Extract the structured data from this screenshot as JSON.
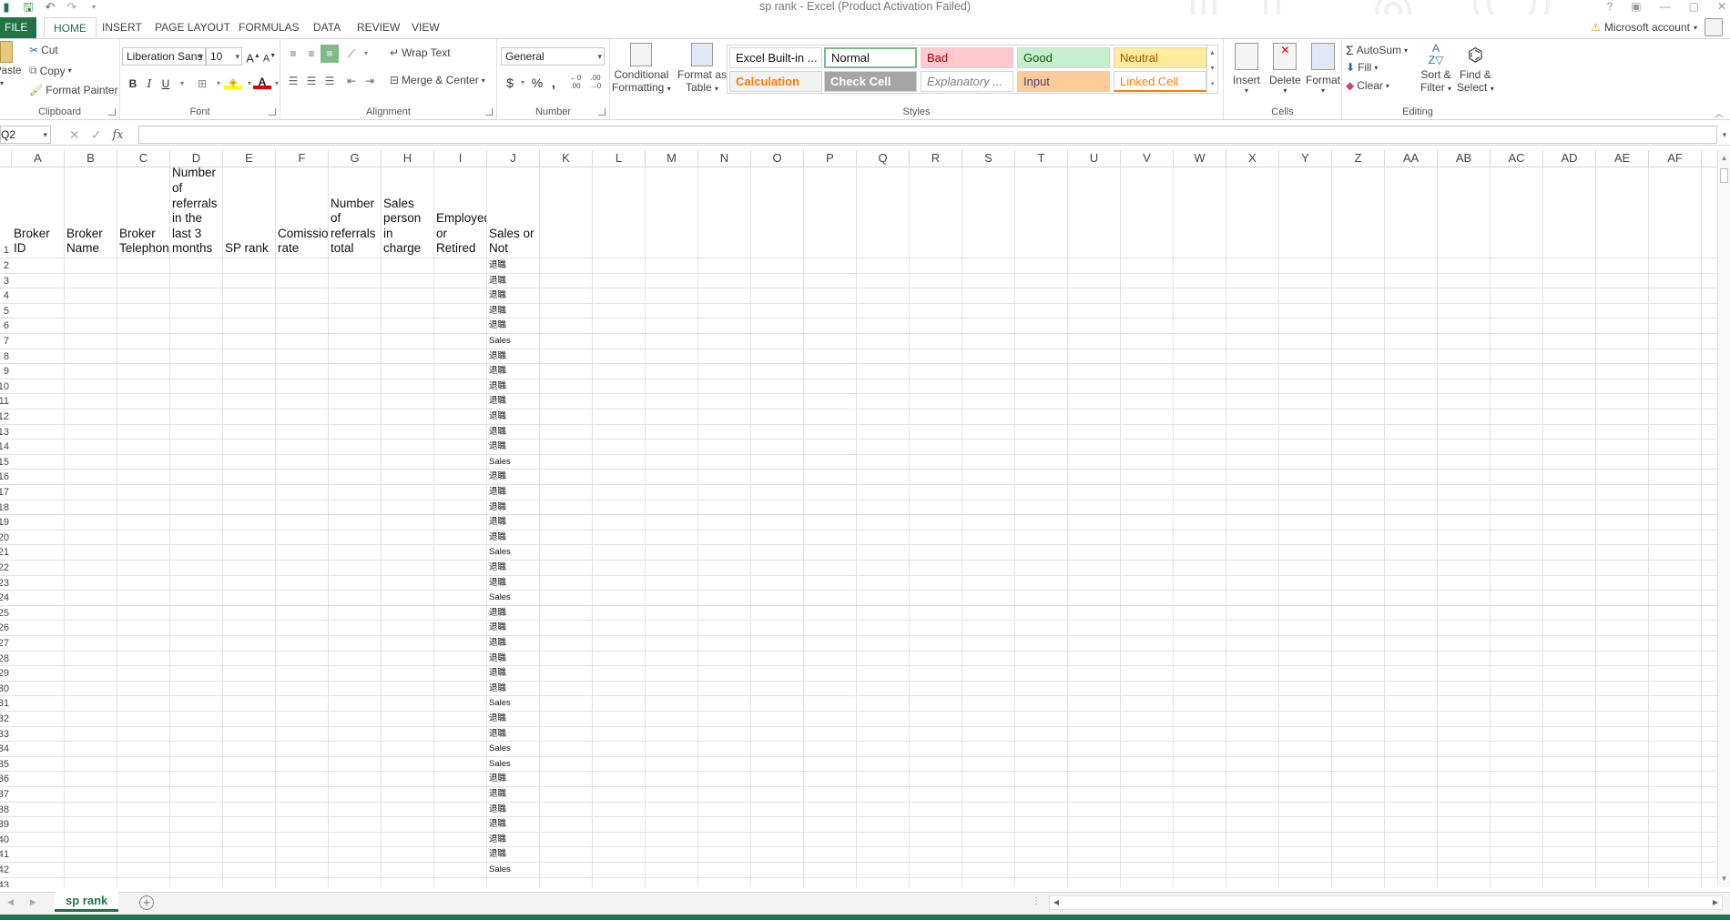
{
  "window": {
    "title": "sp rank - Excel (Product Activation Failed)",
    "account": "Microsoft account",
    "accent_color": "#217346"
  },
  "ribbon_tabs": [
    "FILE",
    "HOME",
    "INSERT",
    "PAGE LAYOUT",
    "FORMULAS",
    "DATA",
    "REVIEW",
    "VIEW"
  ],
  "clipboard": {
    "label": "Clipboard",
    "paste": "Paste",
    "cut": "Cut",
    "copy": "Copy",
    "format_painter": "Format Painter"
  },
  "font": {
    "label": "Font",
    "name": "Liberation Sans",
    "size": "10",
    "bold": "B",
    "italic": "I",
    "underline": "U"
  },
  "alignment": {
    "label": "Alignment",
    "wrap_text": "Wrap Text",
    "merge_center": "Merge & Center"
  },
  "number": {
    "label": "Number",
    "format": "General",
    "currency": "$",
    "percent": "%",
    "comma": ","
  },
  "styles": {
    "label": "Styles",
    "conditional_formatting": [
      "Conditional",
      "Formatting"
    ],
    "format_as_table": [
      "Format as",
      "Table"
    ],
    "boxes": [
      {
        "name": "Excel Built-in ...",
        "bg": "#ffffff",
        "fg": "#111111"
      },
      {
        "name": "Normal",
        "bg": "#ffffff",
        "fg": "#111111",
        "selected": true
      },
      {
        "name": "Bad",
        "bg": "#ffc7ce",
        "fg": "#9c0006"
      },
      {
        "name": "Good",
        "bg": "#c6efce",
        "fg": "#006100"
      },
      {
        "name": "Neutral",
        "bg": "#ffeb9c",
        "fg": "#9c5700"
      },
      {
        "name": "Calculation",
        "bg": "#f2f2f2",
        "fg": "#fa7d00"
      },
      {
        "name": "Check Cell",
        "bg": "#a5a5a5",
        "fg": "#ffffff"
      },
      {
        "name": "Explanatory ...",
        "bg": "#ffffff",
        "fg": "#7f7f7f"
      },
      {
        "name": "Input",
        "bg": "#ffcc99",
        "fg": "#3f3f76"
      },
      {
        "name": "Linked Cell",
        "bg": "#ffffff",
        "fg": "#fa7d00"
      }
    ]
  },
  "cells_group": {
    "label": "Cells",
    "insert": "Insert",
    "delete": "Delete",
    "format": "Format"
  },
  "editing": {
    "label": "Editing",
    "autosum": "AutoSum",
    "fill": "Fill",
    "clear": "Clear",
    "sort_filter": [
      "Sort &",
      "Filter"
    ],
    "find_select": [
      "Find &",
      "Select"
    ]
  },
  "formula_bar": {
    "name_box": "Q2",
    "fx": "fx",
    "value": ""
  },
  "columns": [
    "A",
    "B",
    "C",
    "D",
    "E",
    "F",
    "G",
    "H",
    "I",
    "J",
    "K",
    "L",
    "M",
    "N",
    "O",
    "P",
    "Q",
    "R",
    "S",
    "T",
    "U",
    "V",
    "W",
    "X",
    "Y",
    "Z",
    "AA",
    "AB",
    "AC",
    "AD",
    "AE",
    "AF"
  ],
  "header_row": [
    "Broker ID",
    "Broker Name",
    "Broker Telephone",
    "Number of referrals in the last 3 months",
    "SP rank",
    "Comission rate",
    "Number of referrals total",
    "Sales person in charge",
    "Employed or Retired",
    "Sales or Not"
  ],
  "row_numbers": [
    "1",
    "2",
    "3",
    "4",
    "5",
    "6",
    "7",
    "8",
    "9",
    "10",
    "11",
    "12",
    "13",
    "14",
    "15",
    "16",
    "17",
    "18",
    "19",
    "20",
    "21",
    "22",
    "23",
    "24",
    "25",
    "26",
    "27",
    "28",
    "29",
    "30",
    "31",
    "32",
    "33",
    "34",
    "35",
    "36",
    "37",
    "38",
    "39",
    "40",
    "41",
    "42",
    "43"
  ],
  "column_j_values": [
    "退職",
    "退職",
    "退職",
    "退職",
    "退職",
    "Sales",
    "退職",
    "退職",
    "退職",
    "退職",
    "退職",
    "退職",
    "退職",
    "Sales",
    "退職",
    "退職",
    "退職",
    "退職",
    "退職",
    "Sales",
    "退職",
    "退職",
    "Sales",
    "退職",
    "退職",
    "退職",
    "退職",
    "退職",
    "退職",
    "Sales",
    "退職",
    "退職",
    "Sales",
    "Sales",
    "退職",
    "退職",
    "退職",
    "退職",
    "退職",
    "退職",
    "Sales"
  ],
  "sheet_tab": "sp rank"
}
